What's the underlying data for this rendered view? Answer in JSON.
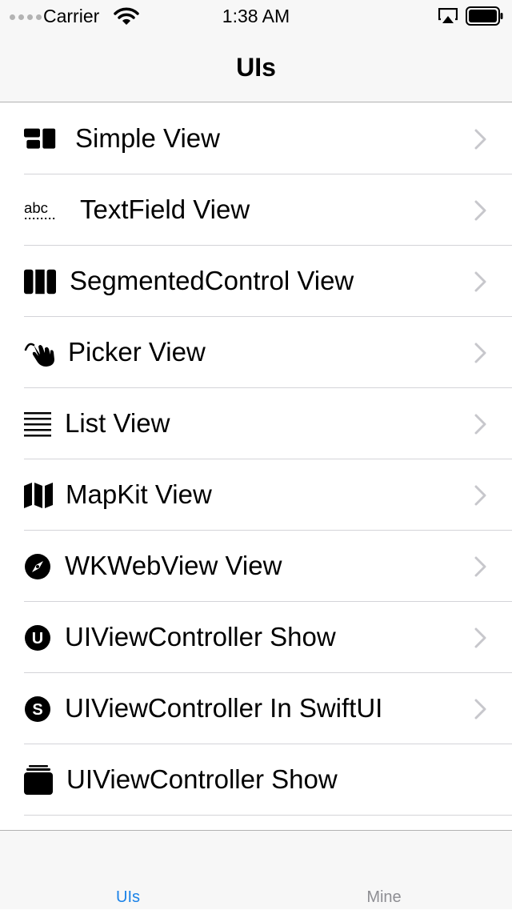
{
  "status_bar": {
    "carrier": "Carrier",
    "time": "1:38 AM"
  },
  "nav": {
    "title": "UIs"
  },
  "list": {
    "items": [
      {
        "label": "Simple View",
        "icon": "rectangle-3-group-icon",
        "chevron": true
      },
      {
        "label": "TextField View",
        "icon": "textformat-abc-icon",
        "chevron": true
      },
      {
        "label": "SegmentedControl View",
        "icon": "rectangle-split-3x1-icon",
        "chevron": true
      },
      {
        "label": "Picker View",
        "icon": "hand-draw-icon",
        "chevron": true
      },
      {
        "label": "List View",
        "icon": "text-justify-icon",
        "chevron": true
      },
      {
        "label": "MapKit View",
        "icon": "map-icon",
        "chevron": true
      },
      {
        "label": "WKWebView View",
        "icon": "safari-compass-icon",
        "chevron": true
      },
      {
        "label": "UIViewController Show",
        "icon": "u-circle-icon",
        "chevron": true
      },
      {
        "label": "UIViewController In SwiftUI",
        "icon": "s-circle-icon",
        "chevron": true
      },
      {
        "label": "UIViewController Show",
        "icon": "rectangle-stack-icon",
        "chevron": false
      }
    ]
  },
  "tab_bar": {
    "tabs": [
      {
        "label": "UIs",
        "active": true
      },
      {
        "label": "Mine",
        "active": false
      }
    ]
  },
  "colors": {
    "accent": "#1a82e8",
    "inactive_tab": "#8e8e93",
    "bar_background": "#f7f7f7",
    "chevron": "#c7c7cc"
  }
}
